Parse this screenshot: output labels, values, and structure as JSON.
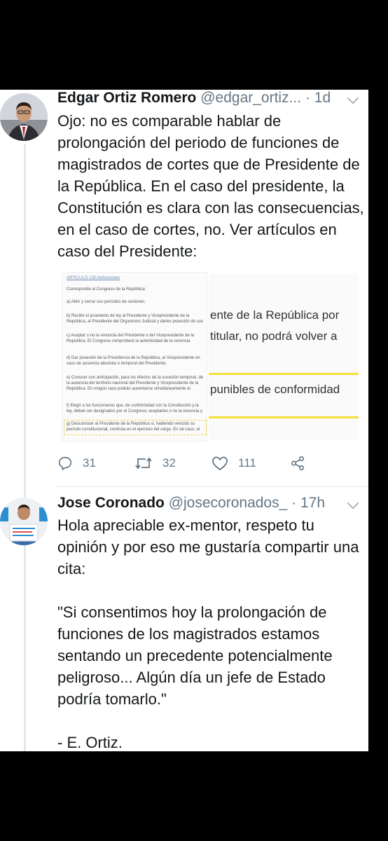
{
  "tweet1": {
    "name": "Edgar Ortiz Romero",
    "handle": "@edgar_ortiz...",
    "dot": "·",
    "time": "1d",
    "text": "Ojo: no es comparable hablar de prolongación del periodo de funciones de magistrados de cortes que de Presidente de la República. En el caso del presidente, la Constitución es clara con las consecuencias, en el caso de cortes, no. Ver artículos en caso del Presidente:",
    "media_left": {
      "heading": "ARTICULO 135 Atribuciones",
      "lines": [
        "Corresponde al Congreso de la República:",
        "a) Abrir y cerrar sus períodos de sesiones;",
        "b) Recibir el juramento de ley al Presidente y Vicepresidente de la República, al Presidente del Organismo Judicial y darles posesión de sus cargos;",
        "c) Aceptar o no la renuncia del Presidente o del Vicepresidente de la República. El Congreso comprobará la autenticidad de la renuncia respectiva;",
        "d) Dar posesión de la Presidencia de la República, al Vicepresidente en caso de ausencia absoluta o temporal del Presidente;",
        "e) Conocer con anticipación, para los efectos de la sucesión temporal, de la ausencia del territorio nacional del Presidente y Vicepresidente de la República. En ningún caso podrán ausentarse simultáneamente el Presidente y Vicepresidente;",
        "f) Elegir a los funcionarios que, de conformidad con la Constitución y la ley, deban ser designados por el Congreso; aceptarles o no la renuncia y elegir a las personas que han de sustituirlos;",
        "g) Desconocer al Presidente de la República si, habiendo vencido su período constitucional, continúa en el ejercicio del cargo. En tal caso, el Ejército pasará automáticamente a depender del Congreso;"
      ]
    },
    "media_right": {
      "line1": "ente de la República por",
      "line2": "titular, no podrá volver a",
      "line3": "punibles de conformidad"
    },
    "replies": "31",
    "retweets": "32",
    "likes": "111"
  },
  "tweet2": {
    "name": "Jose Coronado",
    "handle": "@josecoronados_",
    "dot": "·",
    "time": "17h",
    "text": "Hola apreciable ex-mentor, respeto tu opinión y por eso me gustaría compartir una cita:\n\n\"Si consentimos hoy la prolongación de funciones de los magistrados estamos sentando un precedente potencialmente peligroso... Algún día un jefe de Estado podría tomarlo.\"\n\n- E. Ortiz."
  },
  "icons": [
    "reply-icon",
    "retweet-icon",
    "like-icon",
    "share-icon",
    "chevron-down-icon"
  ],
  "colors": {
    "text": "#14171a",
    "secondary": "#657786",
    "divider": "#e1e8ed",
    "highlight": "#f5e03a",
    "background": "#000000"
  }
}
